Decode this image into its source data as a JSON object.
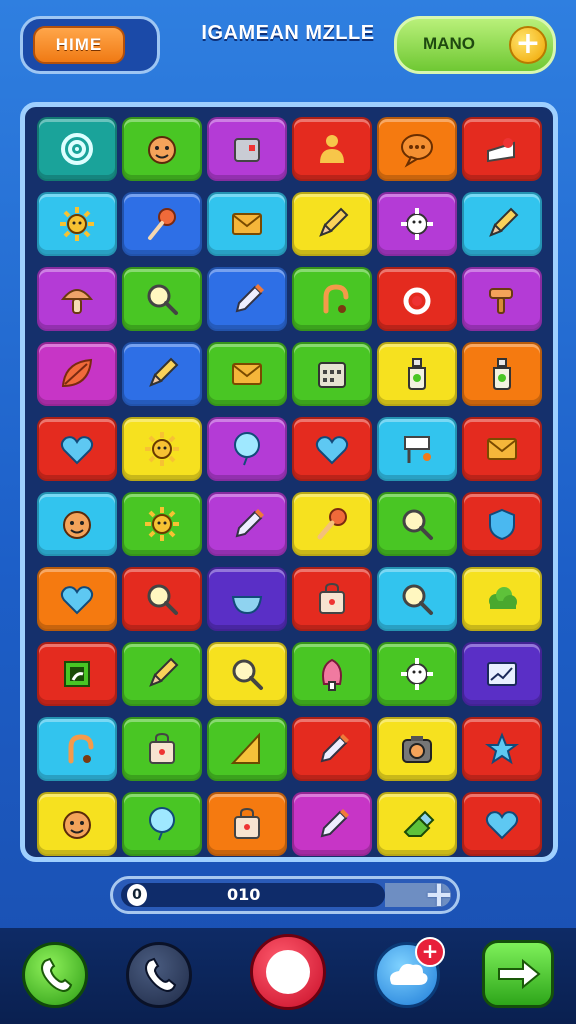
{
  "header": {
    "home_label": "HIME",
    "title": "IGAMEAN MZLLE",
    "mano_label": "MANO",
    "plus_symbol": "+"
  },
  "board": {
    "colors": {
      "teal": "#1aa39a",
      "green": "#49c624",
      "purple": "#b43bd6",
      "red": "#e42b1f",
      "orange": "#f57a10",
      "cyan": "#32c4ee",
      "blue": "#2e6fe6",
      "yellow": "#f6e11f",
      "violet": "#5a2fc6",
      "magenta": "#c735c6"
    },
    "rows": [
      [
        {
          "c": "teal",
          "i": "spiral-icon"
        },
        {
          "c": "green",
          "i": "face-icon"
        },
        {
          "c": "purple",
          "i": "box-icon"
        },
        {
          "c": "red",
          "i": "person-icon"
        },
        {
          "c": "orange",
          "i": "chat-icon"
        },
        {
          "c": "red",
          "i": "cake-icon"
        }
      ],
      [
        {
          "c": "cyan",
          "i": "sun-icon"
        },
        {
          "c": "blue",
          "i": "lollipop-icon"
        },
        {
          "c": "cyan",
          "i": "envelope-icon"
        },
        {
          "c": "yellow",
          "i": "pencil-icon"
        },
        {
          "c": "purple",
          "i": "gear-icon"
        },
        {
          "c": "cyan",
          "i": "pencil-icon"
        }
      ],
      [
        {
          "c": "purple",
          "i": "mushroom-icon"
        },
        {
          "c": "green",
          "i": "magnifier-icon"
        },
        {
          "c": "blue",
          "i": "pen-icon"
        },
        {
          "c": "green",
          "i": "hook-icon"
        },
        {
          "c": "red",
          "i": "ring-icon"
        },
        {
          "c": "purple",
          "i": "hammer-icon"
        }
      ],
      [
        {
          "c": "magenta",
          "i": "leaf-icon"
        },
        {
          "c": "blue",
          "i": "pencil-icon"
        },
        {
          "c": "green",
          "i": "envelope-icon"
        },
        {
          "c": "green",
          "i": "calendar-icon"
        },
        {
          "c": "yellow",
          "i": "bottle-icon"
        },
        {
          "c": "orange",
          "i": "bottle-icon"
        }
      ],
      [
        {
          "c": "red",
          "i": "heart-icon"
        },
        {
          "c": "yellow",
          "i": "sun-icon"
        },
        {
          "c": "purple",
          "i": "balloon-icon"
        },
        {
          "c": "red",
          "i": "heart-icon"
        },
        {
          "c": "cyan",
          "i": "sign-icon"
        },
        {
          "c": "red",
          "i": "envelope-icon"
        }
      ],
      [
        {
          "c": "cyan",
          "i": "face-icon"
        },
        {
          "c": "green",
          "i": "sun-icon"
        },
        {
          "c": "purple",
          "i": "pen-icon"
        },
        {
          "c": "yellow",
          "i": "microphone-icon"
        },
        {
          "c": "green",
          "i": "magnifier-icon"
        },
        {
          "c": "red",
          "i": "shield-icon"
        }
      ],
      [
        {
          "c": "orange",
          "i": "heart-icon"
        },
        {
          "c": "red",
          "i": "magnifier-icon"
        },
        {
          "c": "violet",
          "i": "bowl-icon"
        },
        {
          "c": "red",
          "i": "bag-icon"
        },
        {
          "c": "cyan",
          "i": "magnifier-icon"
        },
        {
          "c": "yellow",
          "i": "bush-icon"
        }
      ],
      [
        {
          "c": "red",
          "i": "frame-icon"
        },
        {
          "c": "green",
          "i": "pencil-icon"
        },
        {
          "c": "yellow",
          "i": "magnifier-icon"
        },
        {
          "c": "green",
          "i": "tree-icon"
        },
        {
          "c": "green",
          "i": "gear-icon"
        },
        {
          "c": "violet",
          "i": "chart-icon"
        }
      ],
      [
        {
          "c": "cyan",
          "i": "hook-icon"
        },
        {
          "c": "green",
          "i": "bag-icon"
        },
        {
          "c": "green",
          "i": "ruler-icon"
        },
        {
          "c": "red",
          "i": "pen-icon"
        },
        {
          "c": "yellow",
          "i": "camera-icon"
        },
        {
          "c": "red",
          "i": "star-icon"
        }
      ],
      [
        {
          "c": "yellow",
          "i": "face-icon"
        },
        {
          "c": "green",
          "i": "balloon-icon"
        },
        {
          "c": "orange",
          "i": "bag-icon"
        },
        {
          "c": "magenta",
          "i": "pen-icon"
        },
        {
          "c": "yellow",
          "i": "eraser-icon"
        },
        {
          "c": "red",
          "i": "heart-icon"
        }
      ]
    ]
  },
  "progress": {
    "knob_label": "0",
    "value_text": "010",
    "fill_fraction": 0.8,
    "plus_symbol": "+"
  },
  "bottom_bar": {
    "buttons": [
      "phone-icon",
      "phone-icon",
      "record-icon",
      "cloud-icon",
      "arrow-right-icon"
    ],
    "badge_symbol": "+"
  }
}
